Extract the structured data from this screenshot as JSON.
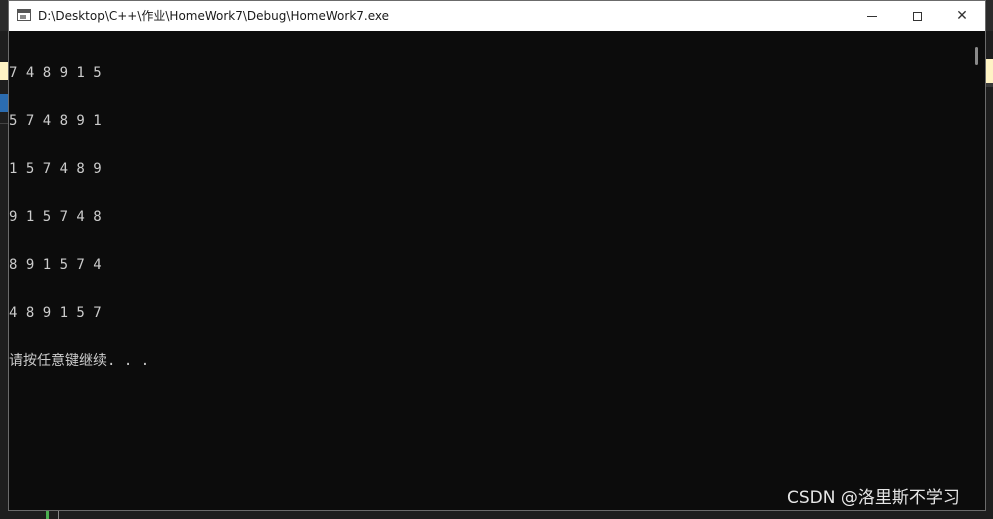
{
  "window": {
    "title": "D:\\Desktop\\C++\\作业\\HomeWork7\\Debug\\HomeWork7.exe",
    "icon": "console-app-icon",
    "controls": {
      "minimize": "minimize-icon",
      "maximize": "maximize-icon",
      "close": "close-icon",
      "close_glyph": "✕"
    }
  },
  "console": {
    "lines": [
      "7 4 8 9 1 5",
      "5 7 4 8 9 1",
      "1 5 7 4 8 9",
      "9 1 5 7 4 8",
      "8 9 1 5 7 4",
      "4 8 9 1 5 7",
      "请按任意键继续. . ."
    ],
    "text_color": "#cccccc",
    "background": "#0c0c0c"
  },
  "watermark": "CSDN @洛里斯不学习"
}
